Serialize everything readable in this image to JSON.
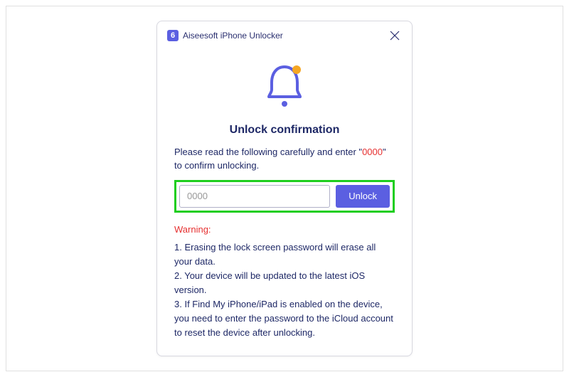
{
  "titlebar": {
    "app_icon_text": "6",
    "title": "Aiseesoft iPhone Unlocker"
  },
  "dialog": {
    "heading": "Unlock confirmation",
    "instruction_prefix": "Please read the following carefully and enter \"",
    "instruction_code": "0000",
    "instruction_suffix": "\" to confirm unlocking.",
    "input_placeholder": "0000",
    "input_value": "",
    "unlock_button": "Unlock",
    "warning_label": "Warning:",
    "warning_items": [
      "1. Erasing the lock screen password will erase all your data.",
      "2. Your device will be updated to the latest iOS version.",
      "3. If Find My iPhone/iPad is enabled on the device, you need to enter the password to the iCloud account to reset the device after unlocking."
    ]
  },
  "colors": {
    "accent": "#5b5fe1",
    "text_primary": "#1e2866",
    "danger": "#e63030",
    "highlight_border": "#1fce1f",
    "notification_dot": "#f5a623"
  }
}
